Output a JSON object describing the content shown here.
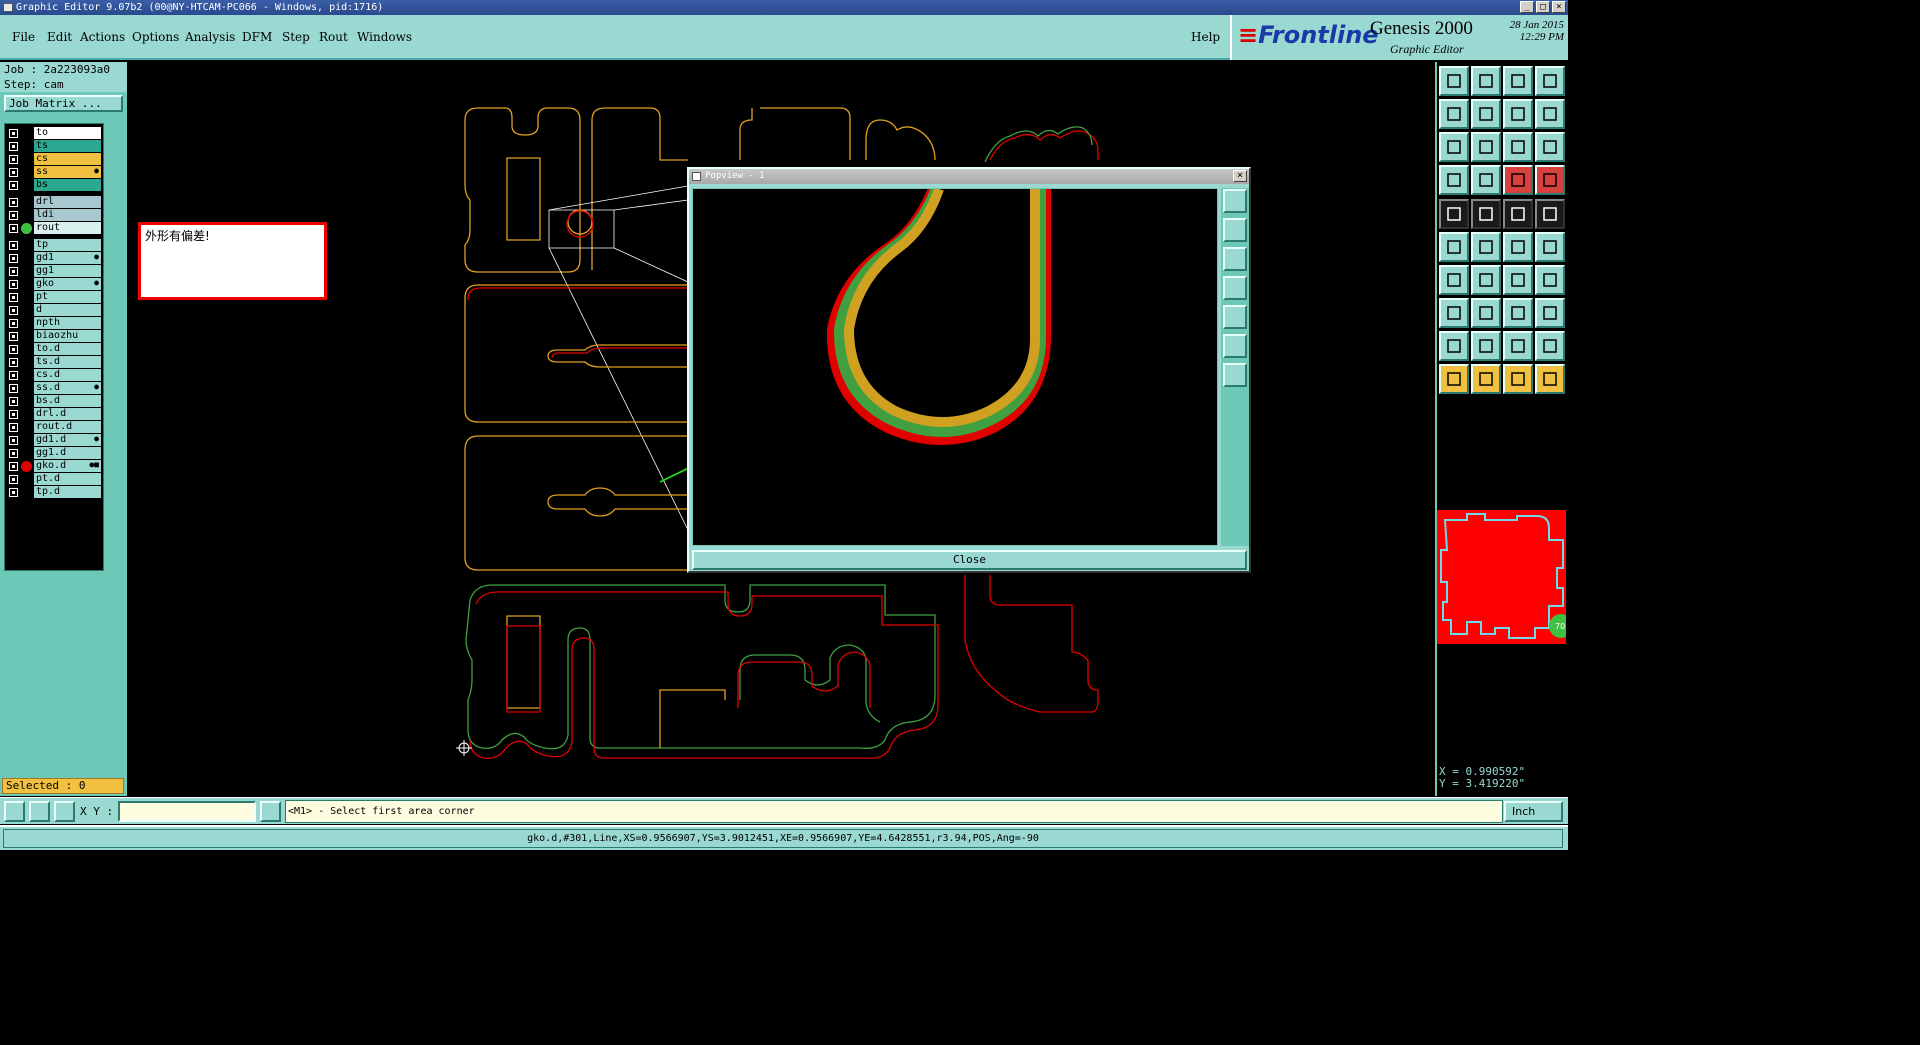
{
  "window": {
    "title": "Graphic Editor 9.07b2 (00@NY-HTCAM-PC066 - Windows, pid:1716)",
    "controls": [
      "_",
      "□",
      "×"
    ]
  },
  "menu": {
    "items": [
      {
        "label": "File"
      },
      {
        "label": "Edit"
      },
      {
        "label": "Actions"
      },
      {
        "label": "Options"
      },
      {
        "label": "Analysis"
      },
      {
        "label": "DFM"
      },
      {
        "label": "Step"
      },
      {
        "label": "Rout"
      },
      {
        "label": "Windows"
      }
    ],
    "help": "Help"
  },
  "brand": {
    "logo": "Frontline",
    "product": "Genesis 2000",
    "subtitle": "Graphic Editor",
    "date": "28 Jan 2015",
    "time": "12:29 PM"
  },
  "job": {
    "job_line": "Job : 2a223093a0",
    "step_line": "Step: cam",
    "matrix_button": "Job Matrix ..."
  },
  "layers": [
    {
      "name": "to",
      "bg": "#ffffff",
      "dot": ""
    },
    {
      "name": "ts",
      "bg": "#2aa890",
      "dot": ""
    },
    {
      "name": "cs",
      "bg": "#f2c040",
      "dot": ""
    },
    {
      "name": "ss",
      "bg": "#f2c040",
      "dot": "",
      "mark": "●"
    },
    {
      "name": "bs",
      "bg": "#2aa890",
      "dot": ""
    },
    {
      "name": "drl",
      "bg": "#a8c8d0",
      "dot": ""
    },
    {
      "name": "ldi",
      "bg": "#a8c8d0",
      "dot": ""
    },
    {
      "name": "rout",
      "bg": "#d8f0ee",
      "dot": "#40c040"
    },
    {
      "name": "tp",
      "bg": "#9ad8d2",
      "dot": ""
    },
    {
      "name": "gd1",
      "bg": "#9ad8d2",
      "dot": "",
      "mark": "●"
    },
    {
      "name": "gg1",
      "bg": "#9ad8d2",
      "dot": ""
    },
    {
      "name": "gko",
      "bg": "#9ad8d2",
      "dot": "",
      "mark": "●"
    },
    {
      "name": "pt",
      "bg": "#9ad8d2",
      "dot": ""
    },
    {
      "name": "d",
      "bg": "#9ad8d2",
      "dot": ""
    },
    {
      "name": "npth",
      "bg": "#9ad8d2",
      "dot": ""
    },
    {
      "name": "biaozhu",
      "bg": "#9ad8d2",
      "dot": ""
    },
    {
      "name": "to.d",
      "bg": "#9ad8d2",
      "dot": ""
    },
    {
      "name": "ts.d",
      "bg": "#9ad8d2",
      "dot": ""
    },
    {
      "name": "cs.d",
      "bg": "#9ad8d2",
      "dot": ""
    },
    {
      "name": "ss.d",
      "bg": "#9ad8d2",
      "dot": "",
      "mark": "●"
    },
    {
      "name": "bs.d",
      "bg": "#9ad8d2",
      "dot": ""
    },
    {
      "name": "drl.d",
      "bg": "#9ad8d2",
      "dot": ""
    },
    {
      "name": "rout.d",
      "bg": "#9ad8d2",
      "dot": ""
    },
    {
      "name": "gd1.d",
      "bg": "#9ad8d2",
      "dot": "",
      "mark": "●"
    },
    {
      "name": "gg1.d",
      "bg": "#9ad8d2",
      "dot": ""
    },
    {
      "name": "gko.d",
      "bg": "#9ad8d2",
      "dot": "#e00000",
      "mark": "●■",
      "active": true
    },
    {
      "name": "pt.d",
      "bg": "#9ad8d2",
      "dot": ""
    },
    {
      "name": "tp.d",
      "bg": "#9ad8d2",
      "dot": ""
    }
  ],
  "selected": "Selected : 0",
  "note": "外形有偏差!",
  "popview": {
    "title": "Popview - 1",
    "close": "Close"
  },
  "coords": {
    "x": "X = 0.990592\"",
    "y": "Y = 3.419220\""
  },
  "thumb_badge": "70",
  "cmd": {
    "xy_label": "X Y :",
    "xy_value": "",
    "prompt": "<M1> - Select first area corner",
    "units": "Inch"
  },
  "status": "gko.d,#301,Line,XS=0.9566907,YS=3.9012451,XE=0.9566907,YE=4.6428551,r3.94,POS,Ang=-90",
  "colors": {
    "panel": "#9ad8d2",
    "panel_dark": "#6ec8b8",
    "layer_a": "#e0a020",
    "layer_b": "#e00000",
    "layer_c": "#40a040"
  }
}
